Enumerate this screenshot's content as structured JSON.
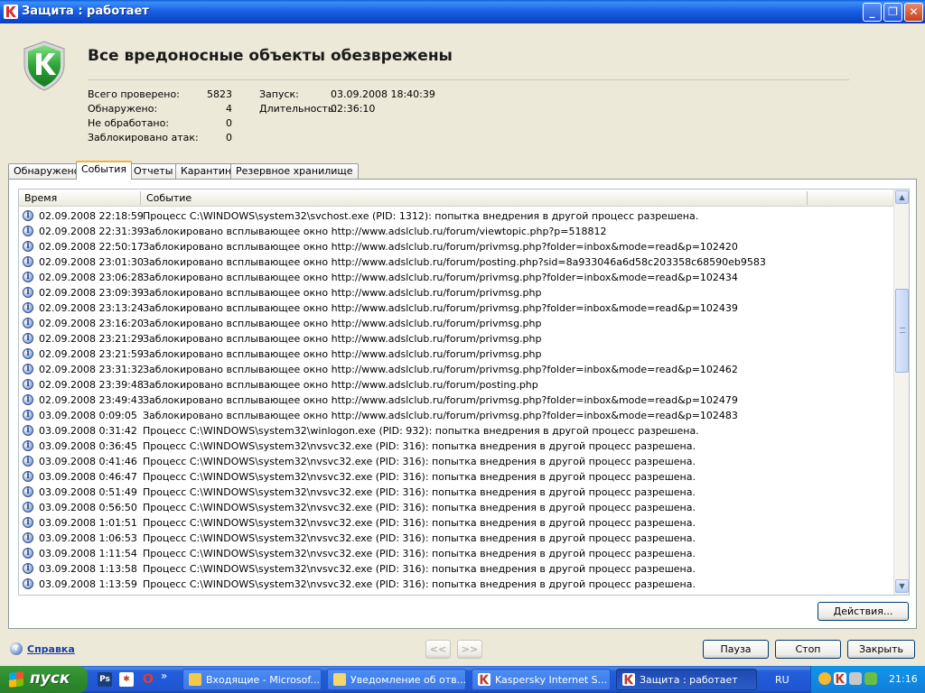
{
  "window": {
    "title": "Защита : работает",
    "minimize": "_",
    "maximize": "❐",
    "close": "✕"
  },
  "header": {
    "title": "Все вредоносные объекты обезврежены",
    "stats": [
      {
        "label": "Всего проверено:",
        "value": "5823"
      },
      {
        "label": "Обнаружено:",
        "value": "4"
      },
      {
        "label": "Не обработано:",
        "value": "0"
      },
      {
        "label": "Заблокировано атак:",
        "value": "0"
      }
    ],
    "meta": [
      {
        "label": "Запуск:",
        "value": "03.09.2008 18:40:39"
      },
      {
        "label": "Длительность:",
        "value": "02:36:10"
      }
    ]
  },
  "tabs": [
    {
      "label": "Обнаружено",
      "active": false
    },
    {
      "label": "События",
      "active": true
    },
    {
      "label": "Отчеты",
      "active": false
    },
    {
      "label": "Карантин",
      "active": false
    },
    {
      "label": "Резервное хранилище",
      "active": false
    }
  ],
  "list": {
    "columns": [
      "Время",
      "Событие"
    ],
    "rows": [
      {
        "time": "02.09.2008 22:18:59",
        "event": "Процесс C:\\WINDOWS\\system32\\svchost.exe (PID: 1312): попытка внедрения в другой процесс разрешена."
      },
      {
        "time": "02.09.2008 22:31:39",
        "event": "Заблокировано всплывающее окно http://www.adslclub.ru/forum/viewtopic.php?p=518812"
      },
      {
        "time": "02.09.2008 22:50:17",
        "event": "Заблокировано всплывающее окно http://www.adslclub.ru/forum/privmsg.php?folder=inbox&mode=read&p=102420"
      },
      {
        "time": "02.09.2008 23:01:30",
        "event": "Заблокировано всплывающее окно http://www.adslclub.ru/forum/posting.php?sid=8a933046a6d58c203358c68590eb9583"
      },
      {
        "time": "02.09.2008 23:06:28",
        "event": "Заблокировано всплывающее окно http://www.adslclub.ru/forum/privmsg.php?folder=inbox&mode=read&p=102434"
      },
      {
        "time": "02.09.2008 23:09:39",
        "event": "Заблокировано всплывающее окно http://www.adslclub.ru/forum/privmsg.php"
      },
      {
        "time": "02.09.2008 23:13:24",
        "event": "Заблокировано всплывающее окно http://www.adslclub.ru/forum/privmsg.php?folder=inbox&mode=read&p=102439"
      },
      {
        "time": "02.09.2008 23:16:20",
        "event": "Заблокировано всплывающее окно http://www.adslclub.ru/forum/privmsg.php"
      },
      {
        "time": "02.09.2008 23:21:29",
        "event": "Заблокировано всплывающее окно http://www.adslclub.ru/forum/privmsg.php"
      },
      {
        "time": "02.09.2008 23:21:59",
        "event": "Заблокировано всплывающее окно http://www.adslclub.ru/forum/privmsg.php"
      },
      {
        "time": "02.09.2008 23:31:32",
        "event": "Заблокировано всплывающее окно http://www.adslclub.ru/forum/privmsg.php?folder=inbox&mode=read&p=102462"
      },
      {
        "time": "02.09.2008 23:39:48",
        "event": "Заблокировано всплывающее окно http://www.adslclub.ru/forum/posting.php"
      },
      {
        "time": "02.09.2008 23:49:43",
        "event": "Заблокировано всплывающее окно http://www.adslclub.ru/forum/privmsg.php?folder=inbox&mode=read&p=102479"
      },
      {
        "time": "03.09.2008 0:09:05",
        "event": "Заблокировано всплывающее окно http://www.adslclub.ru/forum/privmsg.php?folder=inbox&mode=read&p=102483"
      },
      {
        "time": "03.09.2008 0:31:42",
        "event": "Процесс C:\\WINDOWS\\system32\\winlogon.exe (PID: 932): попытка внедрения в другой процесс разрешена."
      },
      {
        "time": "03.09.2008 0:36:45",
        "event": "Процесс C:\\WINDOWS\\system32\\nvsvc32.exe (PID: 316): попытка внедрения в другой процесс разрешена."
      },
      {
        "time": "03.09.2008 0:41:46",
        "event": "Процесс C:\\WINDOWS\\system32\\nvsvc32.exe (PID: 316): попытка внедрения в другой процесс разрешена."
      },
      {
        "time": "03.09.2008 0:46:47",
        "event": "Процесс C:\\WINDOWS\\system32\\nvsvc32.exe (PID: 316): попытка внедрения в другой процесс разрешена."
      },
      {
        "time": "03.09.2008 0:51:49",
        "event": "Процесс C:\\WINDOWS\\system32\\nvsvc32.exe (PID: 316): попытка внедрения в другой процесс разрешена."
      },
      {
        "time": "03.09.2008 0:56:50",
        "event": "Процесс C:\\WINDOWS\\system32\\nvsvc32.exe (PID: 316): попытка внедрения в другой процесс разрешена."
      },
      {
        "time": "03.09.2008 1:01:51",
        "event": "Процесс C:\\WINDOWS\\system32\\nvsvc32.exe (PID: 316): попытка внедрения в другой процесс разрешена."
      },
      {
        "time": "03.09.2008 1:06:53",
        "event": "Процесс C:\\WINDOWS\\system32\\nvsvc32.exe (PID: 316): попытка внедрения в другой процесс разрешена."
      },
      {
        "time": "03.09.2008 1:11:54",
        "event": "Процесс C:\\WINDOWS\\system32\\nvsvc32.exe (PID: 316): попытка внедрения в другой процесс разрешена."
      },
      {
        "time": "03.09.2008 1:13:58",
        "event": "Процесс C:\\WINDOWS\\system32\\nvsvc32.exe (PID: 316): попытка внедрения в другой процесс разрешена."
      },
      {
        "time": "03.09.2008 1:13:59",
        "event": "Процесс C:\\WINDOWS\\system32\\nvsvc32.exe (PID: 316): попытка внедрения в другой процесс разрешена."
      }
    ],
    "scroll_up": "▲",
    "scroll_down": "▼"
  },
  "buttons": {
    "actions": "Действия...",
    "prev": "<<",
    "next": ">>",
    "pause": "Пауза",
    "stop": "Стоп",
    "close": "Закрыть"
  },
  "help": {
    "icon_glyph": "?",
    "label": "Справка"
  },
  "taskbar": {
    "start": "пуск",
    "quicklaunch_more": "»",
    "tasks": [
      {
        "label": "Входящие - Microsof...",
        "icon_color": "#F2C94C",
        "active": false
      },
      {
        "label": "Уведомление об отв...",
        "icon_color": "#F5D76E",
        "active": false
      },
      {
        "label": "Kaspersky Internet S...",
        "icon_color": "#C0392B",
        "active": false
      },
      {
        "label": "Защита : работает",
        "icon_color": "#C0392B",
        "active": true
      }
    ],
    "language": "RU",
    "clock": "21:16"
  },
  "colors": {
    "accent_green": "#2FA33A",
    "titlebar_blue": "#1A62E6",
    "kaspersky_red": "#D32F2F"
  }
}
